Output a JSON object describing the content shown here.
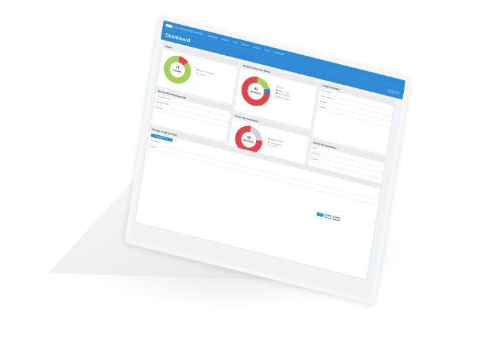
{
  "app": {
    "nav": [
      "DISK ENCRYPTION MANAGER",
      "Dashboard",
      "Devices",
      "Users",
      "Reports",
      "Policies",
      "Admin",
      "Downloads"
    ],
    "page_title": "Dashboard"
  },
  "panels": {
    "teams": {
      "title": "Teams",
      "center_number": "11",
      "center_label": "TEAMS",
      "legend": [
        "BitLocker Encrypted",
        "Unknown"
      ]
    },
    "connection": {
      "title": "Device Connection Status",
      "center_number": "92",
      "center_label": "DEVICES",
      "legend": [
        "Online",
        "Offline 0-7 days",
        "Offline 8-30 days",
        "Offline 30+ days"
      ]
    },
    "usage": {
      "title": "Usage Summary",
      "rows": [
        "Total Devices",
        "Active Licenses",
        "Assigned",
        "Available"
      ]
    },
    "pending": {
      "title": "Devices Pending Approval",
      "rows": [
        "Pending Approval",
        "Approved Today",
        "Rejected"
      ]
    },
    "version": {
      "title": "Device Version Status",
      "center_number": "92",
      "center_label": "DEVICES",
      "legend": [
        "Update Available",
        "Update Required",
        "Up to date"
      ]
    },
    "backup": {
      "title": "Device Backup Status",
      "rows": [
        "Failed",
        "In Progress",
        "Complete"
      ]
    },
    "storage": {
      "title": "Storage Usage by Team",
      "button": "Storage by Team",
      "rows": [
        "Engineering",
        "Finance"
      ],
      "tabs": [
        "7d",
        "30d",
        "90d"
      ]
    }
  },
  "colors": {
    "accent": "#2f8bd6",
    "green": "#a6d05c",
    "red": "#e0474c",
    "blue": "#3d7fd4"
  }
}
